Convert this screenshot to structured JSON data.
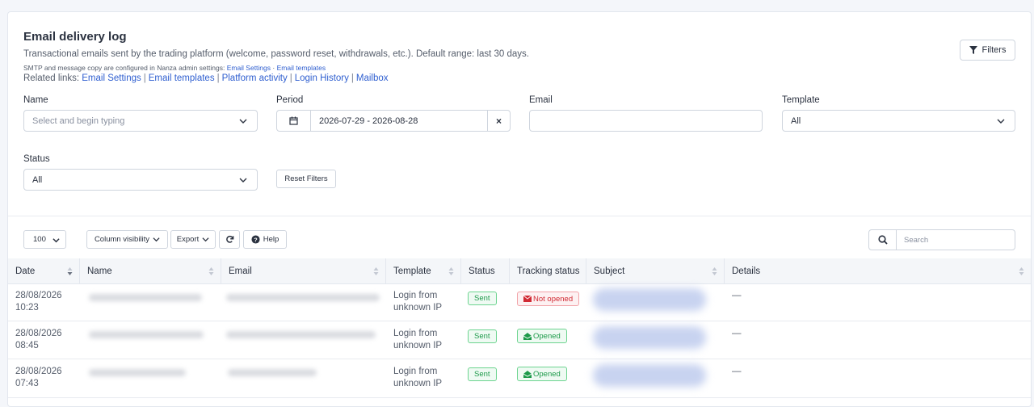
{
  "header": {
    "title": "Email delivery log",
    "description": "Transactional emails sent by the trading platform (welcome, password reset, withdrawals, etc.). Default range: last 30 days.",
    "smtp_note": "SMTP and message copy are configured in Nanza admin settings:",
    "smtp_links": [
      "Email Settings",
      "Email templates"
    ],
    "smtp_sep": "·",
    "related_label": "Related links:",
    "related_links": [
      "Email Settings",
      "Email templates",
      "Platform activity",
      "Login History",
      "Mailbox"
    ],
    "related_sep": "|",
    "filters_button": "Filters"
  },
  "filters": {
    "name_label": "Name",
    "name_placeholder": "Select and begin typing",
    "period_label": "Period",
    "period_value": "2026-07-29 - 2026-08-28",
    "period_clear": "×",
    "email_label": "Email",
    "email_value": "",
    "template_label": "Template",
    "template_value": "All",
    "status_label": "Status",
    "status_value": "All",
    "reset_button": "Reset Filters"
  },
  "toolbar": {
    "page_length": "100",
    "column_visibility": "Column visibility",
    "export": "Export",
    "help": "Help",
    "search_placeholder": "Search"
  },
  "table": {
    "columns": [
      "Date",
      "Name",
      "Email",
      "Template",
      "Status",
      "Tracking status",
      "Subject",
      "Details"
    ],
    "rows": [
      {
        "date": "28/08/2026",
        "time": "10:23",
        "template_l1": "Login from",
        "template_l2": "unknown IP",
        "status": "Sent",
        "tracking": "Not opened",
        "details": "—"
      },
      {
        "date": "28/08/2026",
        "time": "08:45",
        "template_l1": "Login from",
        "template_l2": "unknown IP",
        "status": "Sent",
        "tracking": "Opened",
        "details": "—"
      },
      {
        "date": "28/08/2026",
        "time": "07:43",
        "template_l1": "Login from",
        "template_l2": "unknown IP",
        "status": "Sent",
        "tracking": "Opened",
        "details": "—"
      }
    ]
  },
  "colors": {
    "link": "#2f5fd0",
    "sent_green": "#1d9a4a",
    "not_opened_red": "#d12a33",
    "header_bg": "#f4f6f9"
  },
  "icons": {
    "filters": "funnel-icon",
    "calendar": "calendar-icon",
    "refresh": "refresh-icon",
    "help": "question-circle-icon",
    "search": "search-icon",
    "not_opened": "envelope-icon",
    "opened": "envelope-open-icon"
  }
}
